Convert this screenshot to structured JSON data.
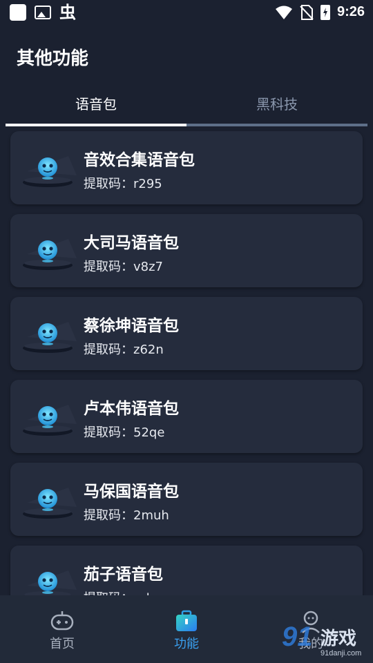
{
  "status_bar": {
    "time": "9:26",
    "bug_glyph": "虫",
    "icons": [
      "app-square-icon",
      "image-icon",
      "wifi-icon",
      "no-sim-icon",
      "battery-charging-icon"
    ]
  },
  "header": {
    "title": "其他功能"
  },
  "tabs": [
    {
      "label": "语音包",
      "active": true
    },
    {
      "label": "黑科技",
      "active": false
    }
  ],
  "cards": [
    {
      "title": "音效合集语音包",
      "code": "提取码：r295"
    },
    {
      "title": "大司马语音包",
      "code": "提取码：v8z7"
    },
    {
      "title": "蔡徐坤语音包",
      "code": "提取码：z62n"
    },
    {
      "title": "卢本伟语音包",
      "code": "提取码：52qe"
    },
    {
      "title": "马保国语音包",
      "code": "提取码：2muh"
    },
    {
      "title": "茄子语音包",
      "code": "提取码：ruku"
    }
  ],
  "bottom_nav": [
    {
      "label": "首页",
      "icon": "gamepad-icon",
      "active": false
    },
    {
      "label": "功能",
      "icon": "toolbox-icon",
      "active": true
    },
    {
      "label": "我的",
      "icon": "profile-icon",
      "active": false
    }
  ],
  "watermark": {
    "mark": "91",
    "text": "游戏",
    "url": "91danji.com"
  },
  "colors": {
    "background": "#1b2130",
    "card": "#252c3d",
    "accent": "#3aa0f0",
    "tab_inactive": "#8a97ad"
  }
}
